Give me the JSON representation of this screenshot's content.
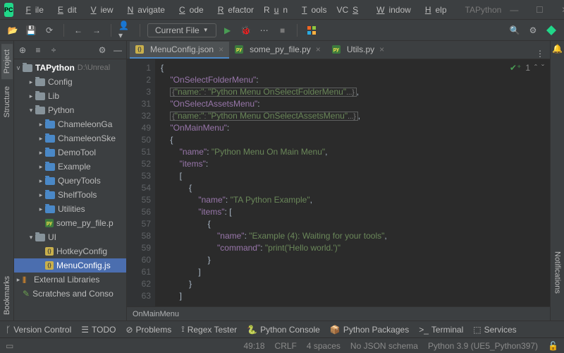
{
  "title_tail": "TAPython",
  "menu": [
    "File",
    "Edit",
    "View",
    "Navigate",
    "Code",
    "Refactor",
    "Run",
    "Tools",
    "VCS",
    "Window",
    "Help"
  ],
  "toolbar": {
    "run_config": "Current File"
  },
  "tree": {
    "root": "TAPython",
    "root_path": "D:\\Unreal",
    "items": [
      {
        "depth": 1,
        "chev": ">",
        "icon": "folder",
        "label": "Config"
      },
      {
        "depth": 1,
        "chev": ">",
        "icon": "folder",
        "label": "Lib"
      },
      {
        "depth": 1,
        "chev": "v",
        "icon": "folder",
        "label": "Python"
      },
      {
        "depth": 2,
        "chev": ">",
        "icon": "folder-blue",
        "label": "ChameleonGa"
      },
      {
        "depth": 2,
        "chev": ">",
        "icon": "folder-blue",
        "label": "ChameleonSke"
      },
      {
        "depth": 2,
        "chev": ">",
        "icon": "folder-blue",
        "label": "DemoTool"
      },
      {
        "depth": 2,
        "chev": ">",
        "icon": "folder-blue",
        "label": "Example"
      },
      {
        "depth": 2,
        "chev": ">",
        "icon": "folder-blue",
        "label": "QueryTools"
      },
      {
        "depth": 2,
        "chev": ">",
        "icon": "folder-blue",
        "label": "ShelfTools"
      },
      {
        "depth": 2,
        "chev": ">",
        "icon": "folder-blue",
        "label": "Utilities"
      },
      {
        "depth": 2,
        "chev": "",
        "icon": "py",
        "label": "some_py_file.p"
      },
      {
        "depth": 1,
        "chev": "v",
        "icon": "folder",
        "label": "UI"
      },
      {
        "depth": 2,
        "chev": "",
        "icon": "js",
        "label": "HotkeyConfig"
      },
      {
        "depth": 2,
        "chev": "",
        "icon": "js",
        "label": "MenuConfig.js",
        "sel": true
      }
    ],
    "ext_lib": "External Libraries",
    "scratch": "Scratches and Conso"
  },
  "sidetabs_left": [
    "Project",
    "Structure",
    "Bookmarks"
  ],
  "sidetabs_right": "Notifications",
  "tabs": [
    {
      "icon": "js",
      "label": "MenuConfig.json",
      "active": true
    },
    {
      "icon": "py",
      "label": "some_py_file.py"
    },
    {
      "icon": "py",
      "label": "Utils.py"
    }
  ],
  "code": {
    "lines": [
      {
        "n": "1",
        "t": "{"
      },
      {
        "n": "2",
        "t": "    \"OnSelectFolderMenu\":"
      },
      {
        "n": "3",
        "t": "    {\"name:\": \"Python Menu OnSelectFolderMenu\"...},",
        "fold": true
      },
      {
        "n": "31",
        "t": "    \"OnSelectAssetsMenu\":"
      },
      {
        "n": "32",
        "t": "    {\"name:\": \"Python Menu OnSelectAssetsMenu\"...},",
        "fold": true
      },
      {
        "n": "49",
        "t": "    \"OnMainMenu\":"
      },
      {
        "n": "50",
        "t": "    {"
      },
      {
        "n": "51",
        "t": "        \"name\": \"Python Menu On Main Menu\","
      },
      {
        "n": "52",
        "t": "        \"items\":"
      },
      {
        "n": "53",
        "t": "        ["
      },
      {
        "n": "54",
        "t": "            {"
      },
      {
        "n": "55",
        "t": "                \"name\": \"TA Python Example\","
      },
      {
        "n": "56",
        "t": "                \"items\": ["
      },
      {
        "n": "57",
        "t": "                    {"
      },
      {
        "n": "58",
        "t": "                        \"name\": \"Example (4): Waiting for your tools\","
      },
      {
        "n": "59",
        "t": "                        \"command\": \"print('Hello world.')\""
      },
      {
        "n": "60",
        "t": "                    }"
      },
      {
        "n": "61",
        "t": "                ]"
      },
      {
        "n": "62",
        "t": "            }"
      },
      {
        "n": "63",
        "t": "        ]"
      }
    ],
    "warn_count": "1"
  },
  "breadcrumb": "OnMainMenu",
  "bottom": [
    "Version Control",
    "TODO",
    "Problems",
    "Regex Tester",
    "Python Console",
    "Python Packages",
    "Terminal",
    "Services"
  ],
  "status": {
    "pos": "49:18",
    "eol": "CRLF",
    "indent": "4 spaces",
    "schema": "No JSON schema",
    "python": "Python 3.9 (UE5_Python397)"
  }
}
